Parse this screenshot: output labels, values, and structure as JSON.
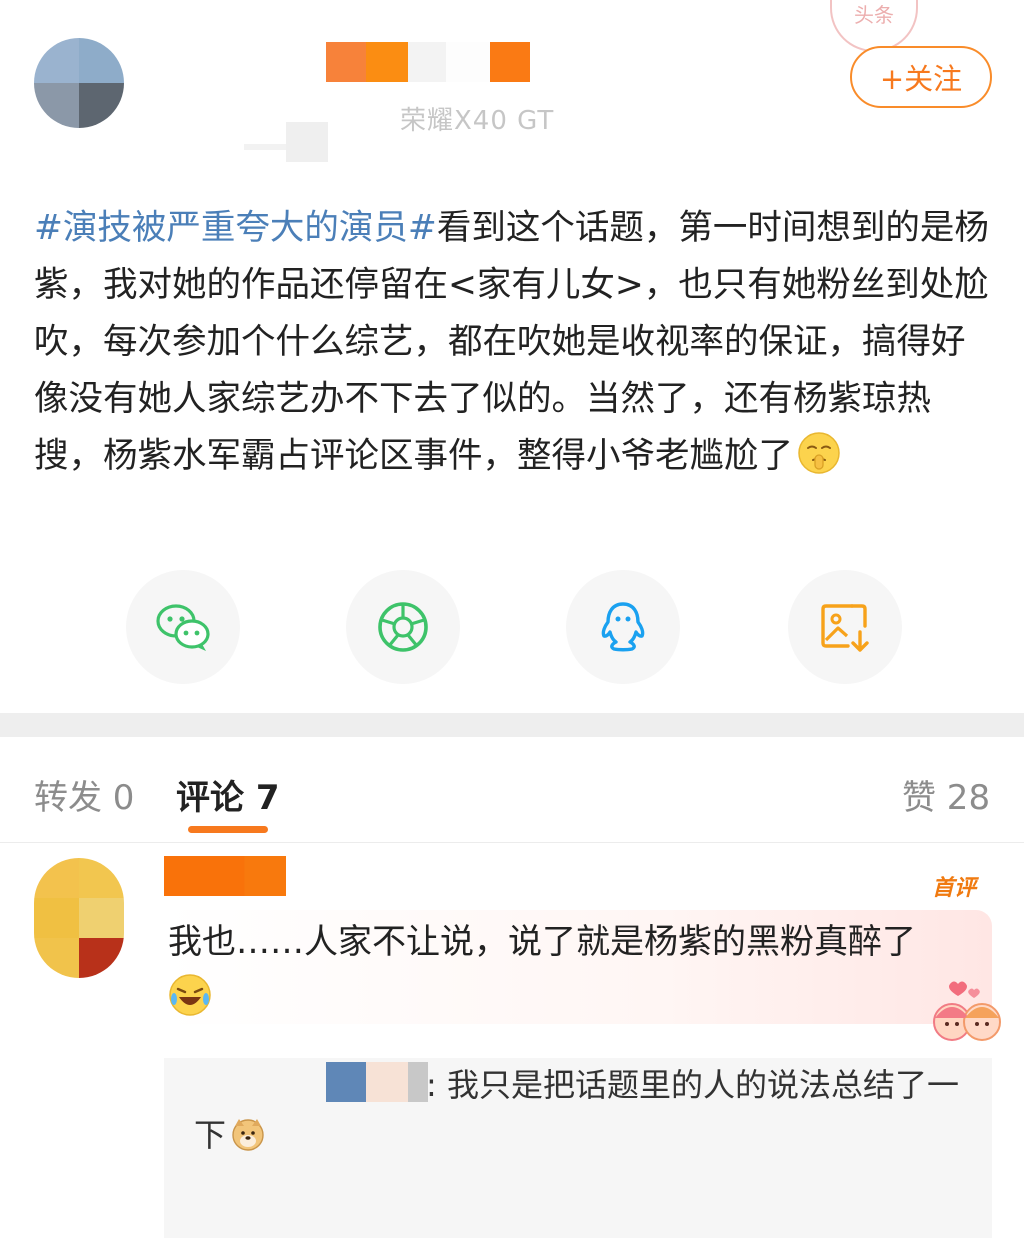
{
  "header": {
    "device": "荣耀X40 GT",
    "stamp_text": "头条",
    "follow_label": "+关注"
  },
  "post": {
    "hashtag": "#演技被严重夸大的演员#",
    "text": "看到这个话题，第一时间想到的是杨紫，我对她的作品还停留在<家有儿女>，也只有她粉丝到处尬吹，每次参加个什么综艺，都在吹她是收视率的保证，搞得好像没有她人家综艺办不下去了似的。当然了，还有杨紫琼热搜，杨紫水军霸占评论区事件，整得小爷老尴尬了",
    "end_emoji": "shush-face-emoji"
  },
  "share": [
    {
      "icon": "wechat-icon",
      "color": "#3ec36a"
    },
    {
      "icon": "moments-icon",
      "color": "#3ec36a"
    },
    {
      "icon": "qq-icon",
      "color": "#1aa1f0"
    },
    {
      "icon": "save-image-icon",
      "color": "#f7a21a"
    }
  ],
  "tabs": {
    "repost": "转发 0",
    "comments": "评论 7",
    "likes": "赞 28"
  },
  "comment": {
    "badge": "首评",
    "text": "我也……人家不让说，说了就是杨紫的黑粉真醉了",
    "emoji": "laughing-crying-emoji",
    "reply_text": ": 我只是把话题里的人的说法总结了一下",
    "reply_emoji": "doge-emoji"
  },
  "colors": {
    "accent": "#f7791e",
    "hashtag": "#4b7fb8"
  }
}
